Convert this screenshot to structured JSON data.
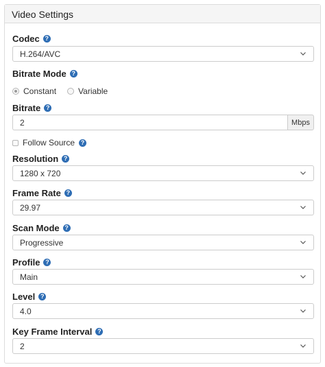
{
  "panel": {
    "title": "Video Settings"
  },
  "codec": {
    "label": "Codec",
    "value": "H.264/AVC"
  },
  "bitrate_mode": {
    "label": "Bitrate Mode",
    "options": [
      "Constant",
      "Variable"
    ],
    "selected": "Constant"
  },
  "bitrate": {
    "label": "Bitrate",
    "value": "2",
    "unit": "Mbps"
  },
  "follow_source": {
    "label": "Follow Source",
    "checked": false
  },
  "resolution": {
    "label": "Resolution",
    "value": "1280 x 720"
  },
  "frame_rate": {
    "label": "Frame Rate",
    "value": "29.97"
  },
  "scan_mode": {
    "label": "Scan Mode",
    "value": "Progressive"
  },
  "profile": {
    "label": "Profile",
    "value": "Main"
  },
  "level": {
    "label": "Level",
    "value": "4.0"
  },
  "key_frame_interval": {
    "label": "Key Frame Interval",
    "value": "2"
  },
  "colors": {
    "help_icon": "#2e6db4",
    "border": "#cccccc"
  },
  "icons": {
    "help": "question-circle-icon",
    "dropdown": "chevron-down-icon"
  }
}
